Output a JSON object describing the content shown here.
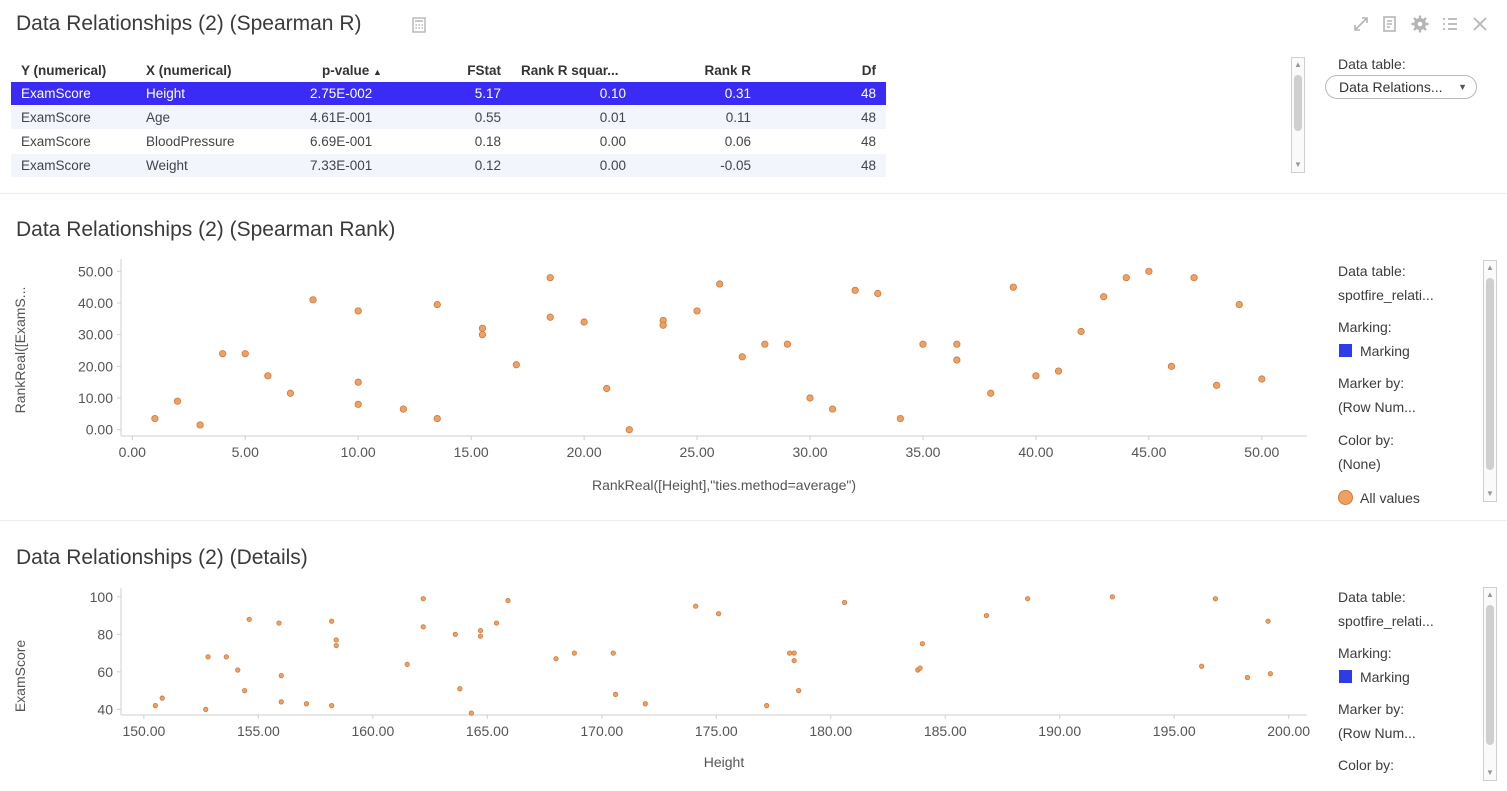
{
  "panels": {
    "table": {
      "title": "Data Relationships (2) (Spearman R)",
      "calc_icon": "calculator-icon",
      "columns": [
        "Y (numerical)",
        "X (numerical)",
        "p-value",
        "FStat",
        "Rank R squar...",
        "Rank R",
        "Df"
      ],
      "sort_indicators": {
        "p-value": "▲",
        "Rank R squar...": "▼"
      },
      "rows": [
        [
          "ExamScore",
          "Height",
          "2.75E-002",
          "5.17",
          "0.10",
          "0.31",
          "48"
        ],
        [
          "ExamScore",
          "Age",
          "4.61E-001",
          "0.55",
          "0.01",
          "0.11",
          "48"
        ],
        [
          "ExamScore",
          "BloodPressure",
          "6.69E-001",
          "0.18",
          "0.00",
          "0.06",
          "48"
        ],
        [
          "ExamScore",
          "Weight",
          "7.33E-001",
          "0.12",
          "0.00",
          "-0.05",
          "48"
        ]
      ],
      "selected_row": 0,
      "side": {
        "data_table_label": "Data table:",
        "data_table_value": "Data Relations..."
      }
    },
    "rank": {
      "title": "Data Relationships (2) (Spearman Rank)",
      "side": {
        "data_table_label": "Data table:",
        "data_table_value": "spotfire_relati...",
        "marking_label": "Marking:",
        "marking_value": "Marking",
        "marker_by_label": "Marker by:",
        "marker_by_value": "(Row Num...",
        "color_by_label": "Color by:",
        "color_by_value": "(None)",
        "legend_value": "All values"
      }
    },
    "details": {
      "title": "Data Relationships (2) (Details)",
      "side": {
        "data_table_label": "Data table:",
        "data_table_value": "spotfire_relati...",
        "marking_label": "Marking:",
        "marking_value": "Marking",
        "marker_by_label": "Marker by:",
        "marker_by_value": "(Row Num...",
        "color_by_label": "Color by:"
      }
    }
  },
  "toolbar": {
    "icons": [
      "maximize-icon",
      "export-icon",
      "settings-icon",
      "list-icon",
      "close-icon"
    ]
  },
  "colors": {
    "marker": "#f0a060",
    "marker_stroke": "#c97a40",
    "marking": "#2d3be8",
    "selected_row": "#3a2cf5"
  },
  "chart_data": [
    {
      "type": "scatter",
      "xlabel": "RankReal([Height],\"ties.method=average\")",
      "ylabel": "RankReal([ExamS...",
      "xlim": [
        -0.5,
        52
      ],
      "ylim": [
        -2,
        52
      ],
      "xticks": [
        "0.00",
        "5.00",
        "10.00",
        "15.00",
        "20.00",
        "25.00",
        "30.00",
        "35.00",
        "40.00",
        "45.00",
        "50.00"
      ],
      "yticks": [
        "0.00",
        "10.00",
        "20.00",
        "30.00",
        "40.00",
        "50.00"
      ],
      "points": [
        [
          1,
          3.5
        ],
        [
          2,
          9
        ],
        [
          3,
          1.5
        ],
        [
          4,
          24
        ],
        [
          5,
          24
        ],
        [
          6,
          17
        ],
        [
          7,
          11.5
        ],
        [
          8,
          41
        ],
        [
          10,
          37.5
        ],
        [
          10,
          15
        ],
        [
          10,
          8
        ],
        [
          12,
          6.5
        ],
        [
          13.5,
          39.5
        ],
        [
          13.5,
          3.5
        ],
        [
          15.5,
          32
        ],
        [
          15.5,
          30
        ],
        [
          17,
          20.5
        ],
        [
          18.5,
          48
        ],
        [
          18.5,
          35.5
        ],
        [
          20,
          34
        ],
        [
          21,
          13
        ],
        [
          22,
          0
        ],
        [
          23.5,
          34.5
        ],
        [
          23.5,
          33
        ],
        [
          25,
          37.5
        ],
        [
          26,
          46
        ],
        [
          27,
          23
        ],
        [
          28,
          27
        ],
        [
          29,
          27
        ],
        [
          30,
          10
        ],
        [
          31,
          6.5
        ],
        [
          32,
          44
        ],
        [
          33,
          43
        ],
        [
          34,
          3.5
        ],
        [
          35,
          27
        ],
        [
          36.5,
          27
        ],
        [
          36.5,
          22
        ],
        [
          38,
          11.5
        ],
        [
          39,
          45
        ],
        [
          40,
          17
        ],
        [
          41,
          18.5
        ],
        [
          42,
          31
        ],
        [
          43,
          42
        ],
        [
          44,
          48
        ],
        [
          45,
          50
        ],
        [
          46,
          20
        ],
        [
          47,
          48
        ],
        [
          48,
          14
        ],
        [
          49,
          39.5
        ],
        [
          50,
          16
        ]
      ]
    },
    {
      "type": "scatter",
      "xlabel": "Height",
      "ylabel": "ExamScore",
      "xlim": [
        149,
        200.8
      ],
      "ylim": [
        37,
        101.5
      ],
      "xticks": [
        "150.00",
        "155.00",
        "160.00",
        "165.00",
        "170.00",
        "175.00",
        "180.00",
        "185.00",
        "190.00",
        "195.00",
        "200.00"
      ],
      "yticks": [
        "40",
        "60",
        "80",
        "100"
      ],
      "points": [
        [
          150.5,
          42
        ],
        [
          150.8,
          46
        ],
        [
          152.7,
          40
        ],
        [
          152.8,
          68
        ],
        [
          153.6,
          68
        ],
        [
          154.1,
          61
        ],
        [
          154.4,
          50
        ],
        [
          154.6,
          88
        ],
        [
          155.9,
          86
        ],
        [
          156.0,
          58
        ],
        [
          156.0,
          44
        ],
        [
          157.1,
          43
        ],
        [
          158.2,
          87
        ],
        [
          158.2,
          42
        ],
        [
          158.4,
          77
        ],
        [
          158.4,
          74
        ],
        [
          161.5,
          64
        ],
        [
          162.2,
          99
        ],
        [
          162.2,
          84
        ],
        [
          163.6,
          80
        ],
        [
          163.8,
          51
        ],
        [
          164.3,
          38
        ],
        [
          164.7,
          82
        ],
        [
          164.7,
          79
        ],
        [
          165.4,
          86
        ],
        [
          165.9,
          98
        ],
        [
          168.0,
          67
        ],
        [
          168.8,
          70
        ],
        [
          170.5,
          70
        ],
        [
          170.6,
          48
        ],
        [
          171.9,
          43
        ],
        [
          174.1,
          95
        ],
        [
          175.1,
          91
        ],
        [
          177.2,
          42
        ],
        [
          178.2,
          70
        ],
        [
          178.4,
          70
        ],
        [
          178.4,
          66
        ],
        [
          178.6,
          50
        ],
        [
          180.6,
          97
        ],
        [
          183.8,
          61
        ],
        [
          183.9,
          62
        ],
        [
          184.0,
          75
        ],
        [
          186.8,
          90
        ],
        [
          188.6,
          99
        ],
        [
          192.3,
          100
        ],
        [
          196.2,
          63
        ],
        [
          196.8,
          99
        ],
        [
          198.2,
          57
        ],
        [
          199.1,
          87
        ],
        [
          199.2,
          59
        ]
      ]
    }
  ]
}
